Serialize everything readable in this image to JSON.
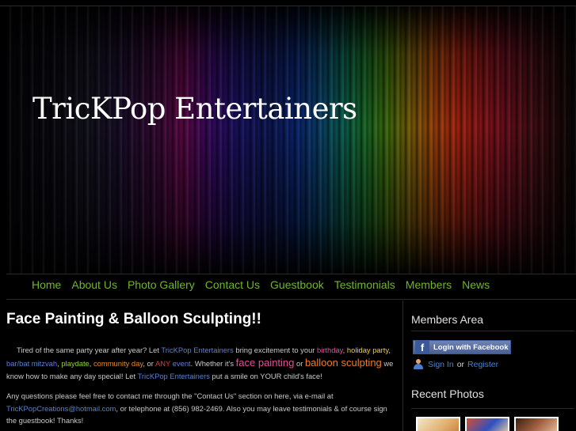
{
  "site": {
    "title": "TricKPop Entertainers"
  },
  "nav": {
    "items": [
      {
        "label": "Home"
      },
      {
        "label": "About Us"
      },
      {
        "label": "Photo Gallery"
      },
      {
        "label": "Contact Us"
      },
      {
        "label": "Guestbook"
      },
      {
        "label": "Testimonials"
      },
      {
        "label": "Members"
      },
      {
        "label": "News"
      }
    ]
  },
  "main": {
    "title": "Face Painting & Balloon Sculpting!!",
    "p1": {
      "t1": "Tired of the same party year after year? Let ",
      "brand1": "TricKPop Entertainers",
      "t2": " bring excitement to your ",
      "birthday": "birthday",
      "t3": ", ",
      "holiday": "holiday party",
      "t4": ", ",
      "mitzvah": "bar/bat mitzvah",
      "t5": ", ",
      "playdate": "playdate",
      "t6": ", ",
      "community": "community day",
      "t7": ", or ",
      "any": "ANY",
      "t8": " ",
      "event": "event",
      "t9": ". Whether it's ",
      "face": "face painting",
      "t10": " or ",
      "balloon": "balloon sculpting",
      "t11": " we know how to make any day special! Let ",
      "brand2": "TricKPop Entertainers",
      "t12": " put a smile on YOUR child's face!"
    },
    "p2": {
      "t1": "Any questions please feel free to contact me through the \"Contact Us\" section on here, via e-mail at ",
      "email": "TricKPopCreations@hotmail.com",
      "t2": ", or telephone at (856) 982-2469. Also you may leave testimonials & of course sign the guestbook! Thanks!"
    }
  },
  "sidebar": {
    "members_title": "Members Area",
    "facebook_label": "Login with Facebook",
    "facebook_logo": "f",
    "signin": "Sign In",
    "or": "or",
    "register": "Register",
    "photos_title": "Recent Photos"
  },
  "icons": {
    "facebook": "facebook-icon",
    "user": "user-icon"
  },
  "colors": {
    "nav_link": "#6fb52c",
    "link_blue": "#4a80d0",
    "facebook_blue": "#3b5998"
  }
}
